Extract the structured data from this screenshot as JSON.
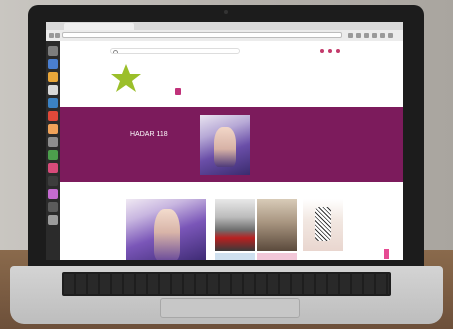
{
  "browser": {
    "tab_title": "",
    "url": ""
  },
  "site": {
    "search_placeholder": "",
    "logo_text": "",
    "nav": [
      {
        "label": ""
      },
      {
        "label": ""
      },
      {
        "label": ""
      },
      {
        "label": ""
      },
      {
        "label": ""
      },
      {
        "label": ""
      },
      {
        "label": ""
      },
      {
        "label": ""
      }
    ],
    "hero": {
      "left_line1": "",
      "left_line2": "HADAR 118",
      "right_line1": "",
      "right_line2": "",
      "cover_label": ""
    },
    "section_label": "",
    "main_cover_label": ""
  },
  "colors": {
    "accent_magenta": "#c0327a",
    "hero_purple": "#7c1b5c"
  }
}
